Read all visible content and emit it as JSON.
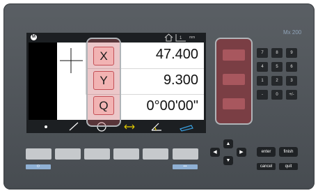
{
  "device": {
    "model": "Mx 200",
    "logo_letter": "M",
    "units_label": "mm"
  },
  "readout": {
    "rows": [
      {
        "axis": "X",
        "value": "47.400"
      },
      {
        "axis": "Y",
        "value": "9.300"
      },
      {
        "axis": "Q",
        "value": "0°00'00\""
      }
    ]
  },
  "toolbar": {
    "tools": [
      "point-icon",
      "line-icon",
      "circle-icon",
      "distance-icon",
      "angle-icon",
      "rectangle-icon"
    ],
    "accent": "#e8d000",
    "rect_color": "#3aa0e0"
  },
  "keypad": {
    "keys": [
      "7",
      "8",
      "9",
      "4",
      "5",
      "6",
      "1",
      "2",
      "3",
      "-",
      "0",
      "+/-"
    ]
  },
  "buttons": {
    "enter": "enter",
    "finish": "finish",
    "cancel": "cancel",
    "quit": "quit",
    "power_symbol": "⏻",
    "more_symbol": "•••"
  },
  "colors": {
    "axis_key_fill": "#f2b3b3",
    "axis_key_border": "#c44f56",
    "func_panel": "#7a3e44"
  }
}
